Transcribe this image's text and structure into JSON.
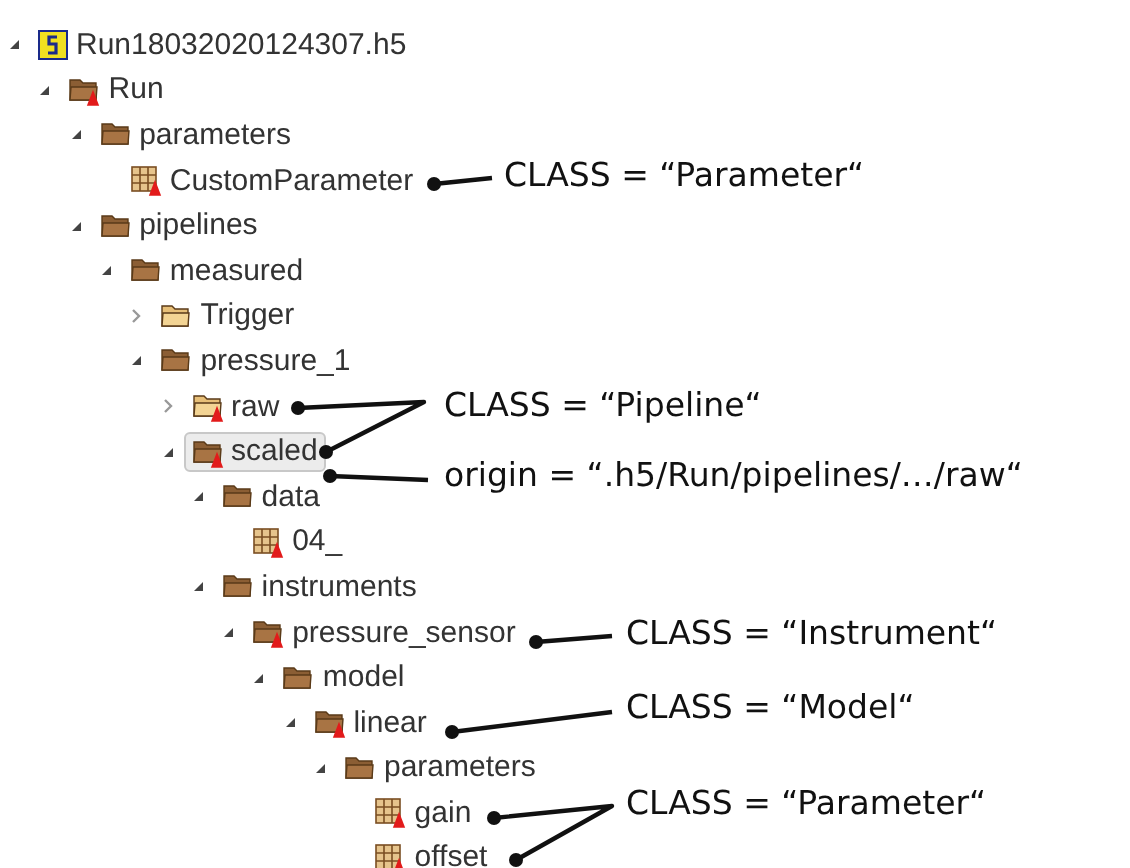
{
  "tree": [
    {
      "label": "Run18032020124307.h5",
      "kind": "file",
      "expanded": true,
      "selected": false,
      "children": [
        {
          "label": "Run",
          "kind": "group_attr",
          "expanded": true,
          "selected": false,
          "children": [
            {
              "label": "parameters",
              "kind": "group",
              "expanded": true,
              "selected": false,
              "children": [
                {
                  "label": "CustomParameter",
                  "kind": "dataset_attr",
                  "selected": false
                }
              ]
            },
            {
              "label": "pipelines",
              "kind": "group",
              "expanded": true,
              "selected": false,
              "children": [
                {
                  "label": "measured",
                  "kind": "group",
                  "expanded": true,
                  "selected": false,
                  "children": [
                    {
                      "label": "Trigger",
                      "kind": "group",
                      "expanded": false,
                      "selected": false
                    },
                    {
                      "label": "pressure_1",
                      "kind": "group",
                      "expanded": true,
                      "selected": false,
                      "children": [
                        {
                          "label": "raw",
                          "kind": "group_attr",
                          "expanded": false,
                          "selected": false
                        },
                        {
                          "label": "scaled",
                          "kind": "group_attr",
                          "expanded": true,
                          "selected": true,
                          "children": [
                            {
                              "label": "data",
                              "kind": "group",
                              "expanded": true,
                              "selected": false,
                              "children": [
                                {
                                  "label": "04_",
                                  "kind": "dataset_attr",
                                  "selected": false
                                }
                              ]
                            },
                            {
                              "label": "instruments",
                              "kind": "group",
                              "expanded": true,
                              "selected": false,
                              "children": [
                                {
                                  "label": "pressure_sensor",
                                  "kind": "group_attr",
                                  "expanded": true,
                                  "selected": false,
                                  "children": [
                                    {
                                      "label": "model",
                                      "kind": "group",
                                      "expanded": true,
                                      "selected": false,
                                      "children": [
                                        {
                                          "label": "linear",
                                          "kind": "group_attr",
                                          "expanded": true,
                                          "selected": false,
                                          "children": [
                                            {
                                              "label": "parameters",
                                              "kind": "group",
                                              "expanded": true,
                                              "selected": false,
                                              "children": [
                                                {
                                                  "label": "gain",
                                                  "kind": "dataset_attr",
                                                  "selected": false
                                                },
                                                {
                                                  "label": "offset",
                                                  "kind": "dataset_attr",
                                                  "selected": false
                                                }
                                              ]
                                            }
                                          ]
                                        }
                                      ]
                                    }
                                  ]
                                }
                              ]
                            }
                          ]
                        }
                      ]
                    }
                  ]
                }
              ]
            }
          ]
        }
      ]
    }
  ],
  "annotations": [
    "CLASS = “Parameter“",
    "CLASS = “Pipeline“",
    "origin = “.h5/Run/pipelines/…/raw“",
    "CLASS = “Instrument“",
    "CLASS = “Model“",
    "CLASS = “Parameter“"
  ]
}
